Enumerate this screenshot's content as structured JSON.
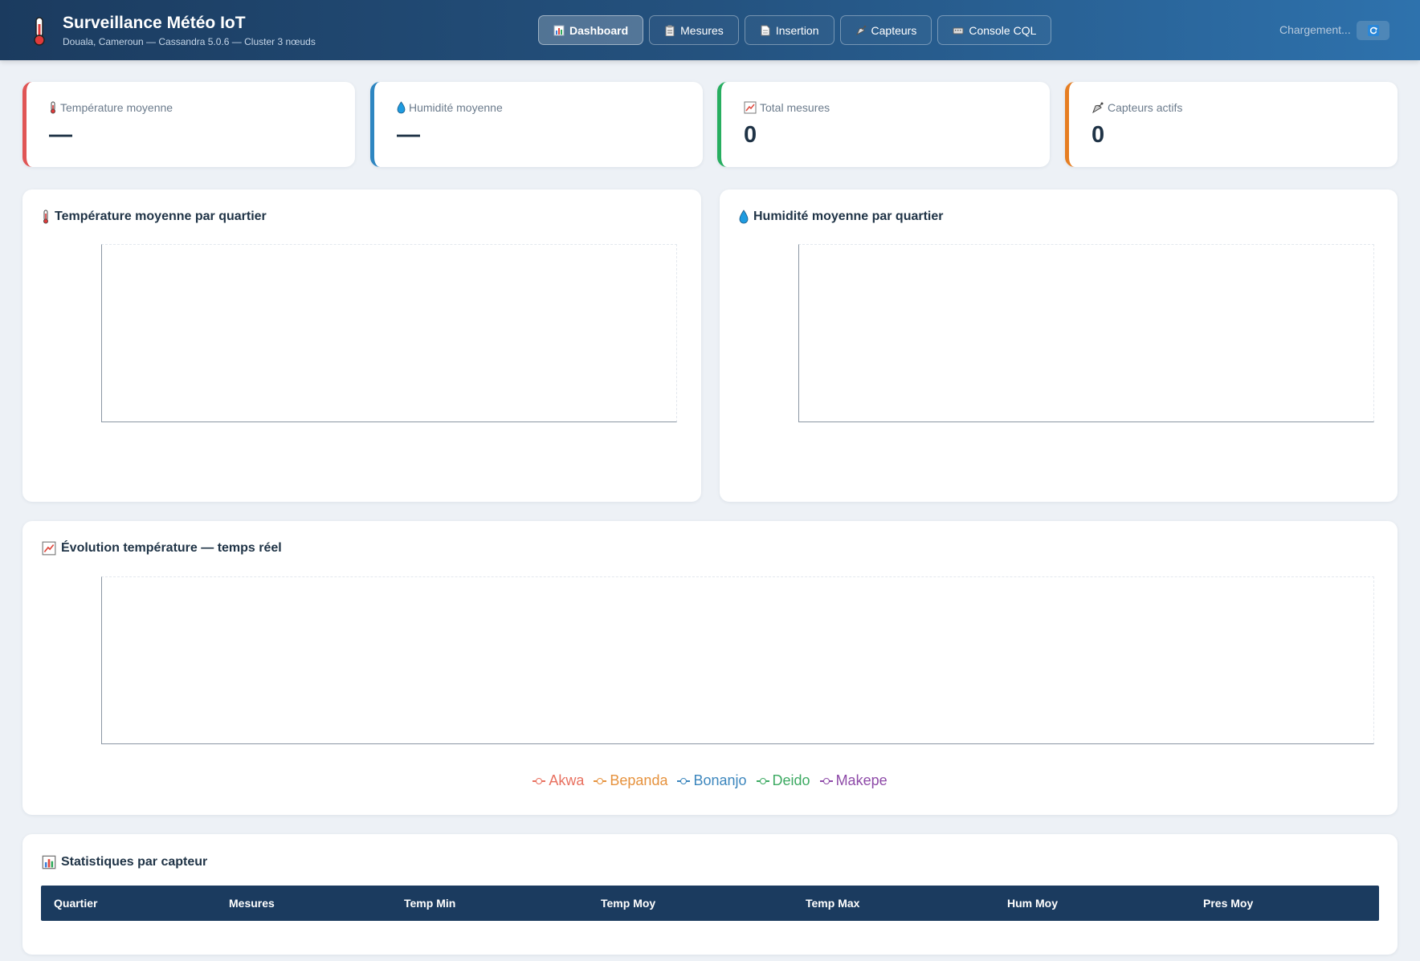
{
  "header": {
    "title": "Surveillance Météo IoT",
    "subtitle": "Douala, Cameroun — Cassandra 5.0.6 — Cluster 3 nœuds",
    "status": "Chargement...",
    "nav": [
      {
        "label": "Dashboard",
        "icon": "bar-chart-icon",
        "active": true
      },
      {
        "label": "Mesures",
        "icon": "clipboard-icon",
        "active": false
      },
      {
        "label": "Insertion",
        "icon": "document-icon",
        "active": false
      },
      {
        "label": "Capteurs",
        "icon": "satellite-icon",
        "active": false
      },
      {
        "label": "Console CQL",
        "icon": "keyboard-icon",
        "active": false
      }
    ]
  },
  "kpis": [
    {
      "label": "Température moyenne",
      "value": "—",
      "icon": "thermometer-icon",
      "color": "#e05555"
    },
    {
      "label": "Humidité moyenne",
      "value": "—",
      "icon": "droplet-icon",
      "color": "#2e86c1"
    },
    {
      "label": "Total mesures",
      "value": "0",
      "icon": "chart-up-icon",
      "color": "#27ae60"
    },
    {
      "label": "Capteurs actifs",
      "value": "0",
      "icon": "satellite-icon",
      "color": "#e67e22"
    }
  ],
  "charts": {
    "temp_title": "Température moyenne par quartier",
    "hum_title": "Humidité moyenne par quartier",
    "evolution_title": "Évolution température — temps réel"
  },
  "chart_data": [
    {
      "type": "bar",
      "categories": [],
      "values": []
    },
    {
      "type": "bar",
      "categories": [],
      "values": []
    },
    {
      "type": "line",
      "x": [],
      "series": [
        {
          "name": "Akwa",
          "values": []
        },
        {
          "name": "Bepanda",
          "values": []
        },
        {
          "name": "Bonanjo",
          "values": []
        },
        {
          "name": "Deido",
          "values": []
        },
        {
          "name": "Makepe",
          "values": []
        }
      ]
    }
  ],
  "legend": [
    {
      "name": "Akwa",
      "color": "#e8705f"
    },
    {
      "name": "Bepanda",
      "color": "#e6923d"
    },
    {
      "name": "Bonanjo",
      "color": "#3c86bd"
    },
    {
      "name": "Deido",
      "color": "#3daa62"
    },
    {
      "name": "Makepe",
      "color": "#8e4aa8"
    }
  ],
  "stats": {
    "title": "Statistiques par capteur",
    "columns": [
      "Quartier",
      "Mesures",
      "Temp Min",
      "Temp Moy",
      "Temp Max",
      "Hum Moy",
      "Pres Moy"
    ],
    "rows": []
  }
}
